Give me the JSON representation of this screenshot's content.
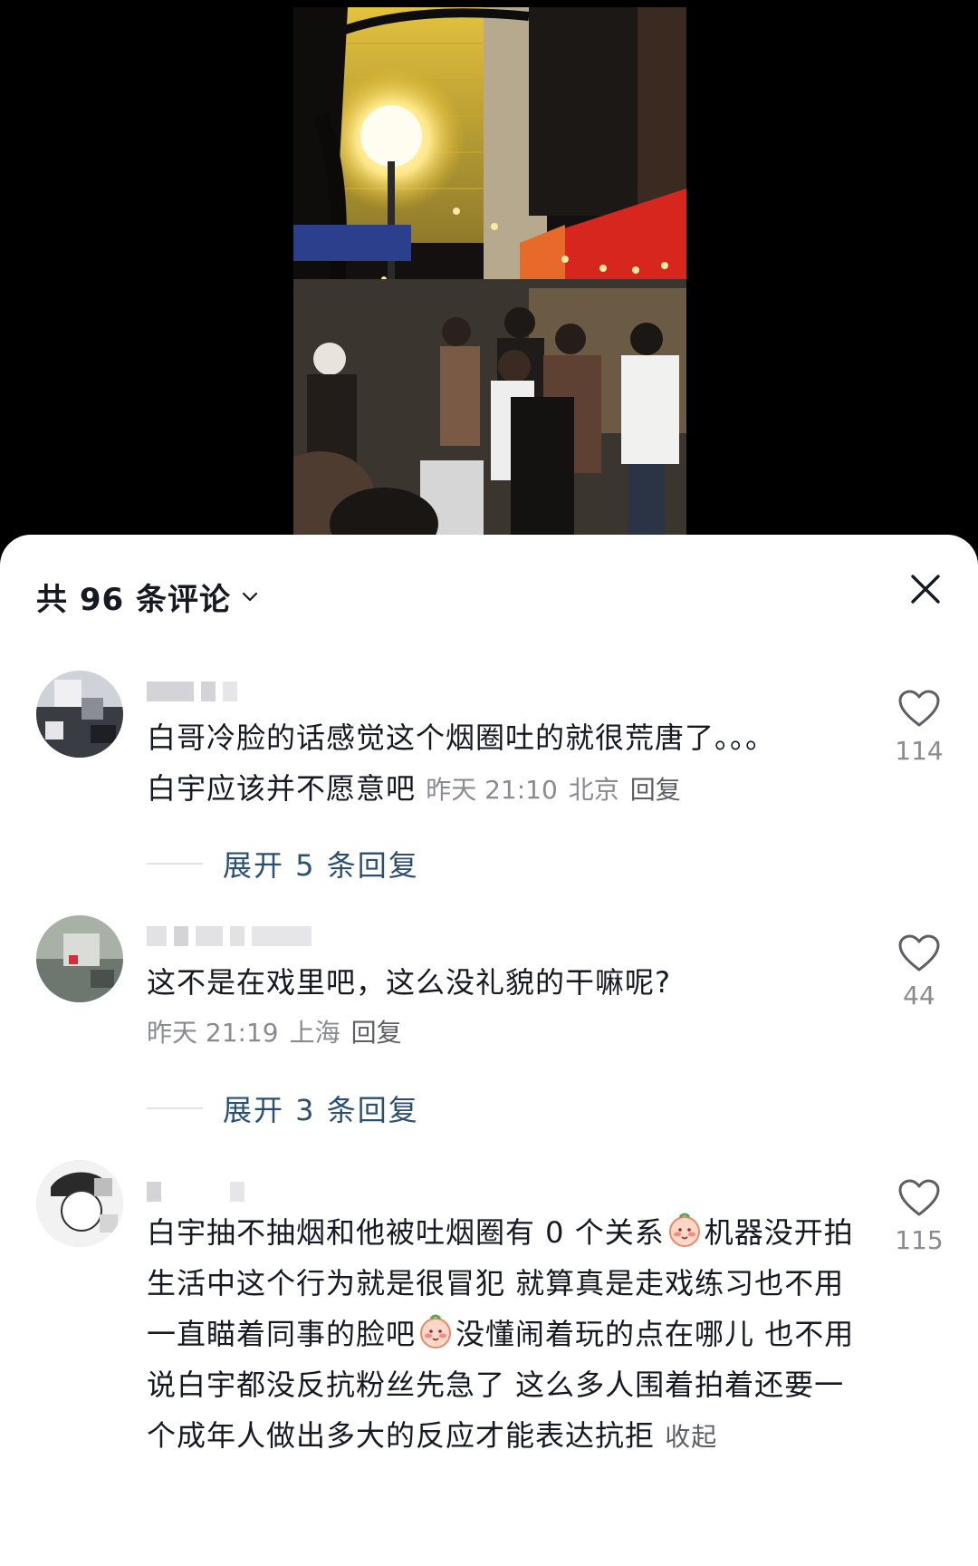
{
  "sheet": {
    "title": "共 96 条评论"
  },
  "comments": [
    {
      "text_line1": "白哥冷脸的话感觉这个烟圈吐的就很荒唐了。。。",
      "text_line2": "白宇应该并不愿意吧",
      "time": "昨天 21:10",
      "location": "北京",
      "reply_label": "回复",
      "likes": "114",
      "expand_label": "展开 5 条回复"
    },
    {
      "text_line1": "这不是在戏里吧，这么没礼貌的干嘛呢?",
      "time": "昨天 21:19",
      "location": "上海",
      "reply_label": "回复",
      "likes": "44",
      "expand_label": "展开 3 条回复"
    },
    {
      "part1": "白宇抽不抽烟和他被吐烟圈有 0 个关系",
      "part2": "机器没开拍 生活中这个行为就是很冒犯 就算真是走戏练习也不用一直瞄着同事的脸吧",
      "part3": "没懂闹着玩的点在哪儿 也不用说白宇都没反抗粉丝先急了 这么多人围着拍着还要一个成年人做出多大的反应才能表达抗拒",
      "collapse_label": "收起",
      "likes": "115"
    }
  ],
  "colors": {
    "accent_link": "#2b4f73",
    "meta": "#8a8b91"
  },
  "icons": [
    "chevron-down-icon",
    "close-icon",
    "heart-icon",
    "blush-emoji-icon"
  ]
}
